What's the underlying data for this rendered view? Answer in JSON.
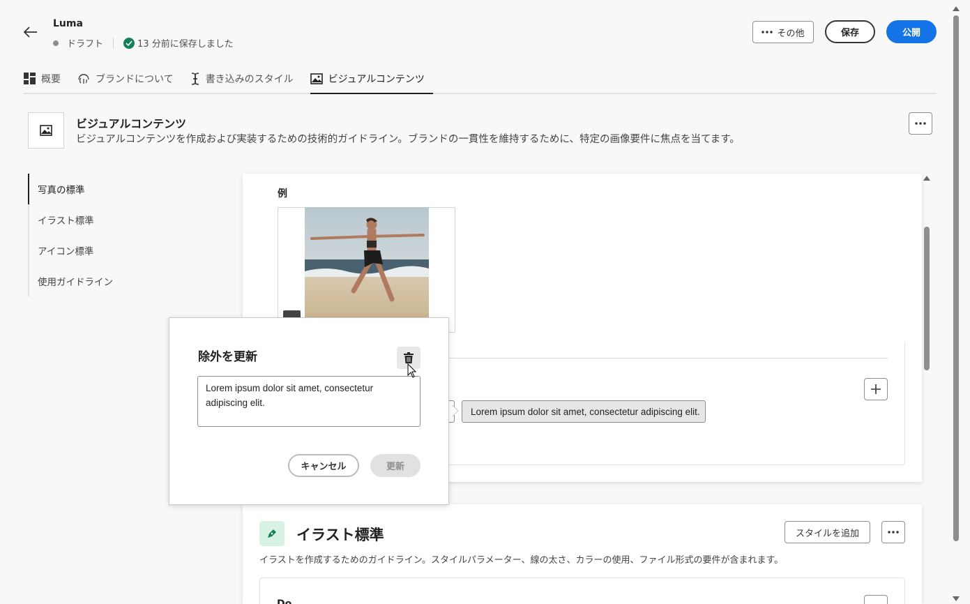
{
  "header": {
    "app_title": "Luma",
    "status": "ドラフト",
    "saved_text": "13 分前に保存しました",
    "more_label": "その他",
    "save_label": "保存",
    "publish_label": "公開"
  },
  "tabs": [
    {
      "label": "概要",
      "icon": "grid-icon"
    },
    {
      "label": "ブランドについて",
      "icon": "fingerprint-icon"
    },
    {
      "label": "書き込みのスタイル",
      "icon": "text-cursor-icon"
    },
    {
      "label": "ビジュアルコンテンツ",
      "icon": "image-icon",
      "active": true
    }
  ],
  "section": {
    "title": "ビジュアルコンテンツ",
    "description": "ビジュアルコンテンツを作成および実装するための技術的ガイドライン。ブランドの一貫性を維持するために、特定の画像要件に焦点を当てます。"
  },
  "leftnav": [
    {
      "label": "写真の標準",
      "active": true
    },
    {
      "label": "イラスト標準"
    },
    {
      "label": "アイコン標準"
    },
    {
      "label": "使用ガイドライン"
    }
  ],
  "content": {
    "example_label": "例",
    "tag_text": "Lorem ipsum dolor sit amet, consectetur adipiscing elit."
  },
  "popover": {
    "title": "除外を更新",
    "textarea_value": "Lorem ipsum dolor sit amet, consectetur adipiscing elit.",
    "cancel_label": "キャンセル",
    "update_label": "更新"
  },
  "illustration": {
    "title": "イラスト標準",
    "description": "イラストを作成するためのガイドライン。スタイルパラメーター、線の太さ、カラーの使用、ファイル形式の要件が含まれます。",
    "add_style_label": "スタイルを追加",
    "sub_label": "Do"
  },
  "colors": {
    "accent": "#1473e6",
    "success": "#12805c",
    "illus_icon_bg": "#d8f2e4"
  }
}
